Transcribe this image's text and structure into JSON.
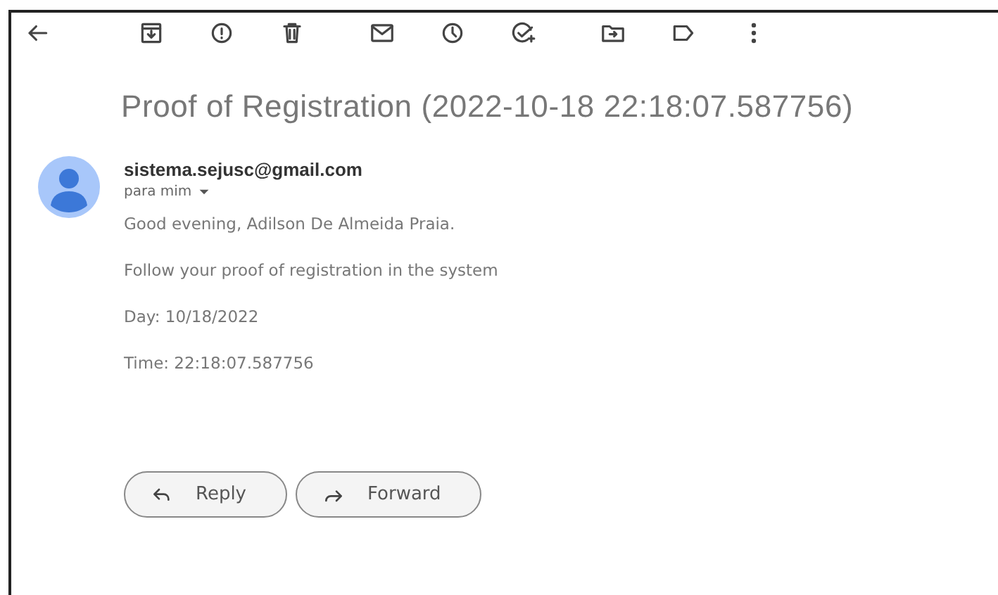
{
  "email": {
    "subject": "Proof of Registration (2022-10-18 22:18:07.587756)",
    "sender": "sistema.sejusc@gmail.com",
    "recipient": "para mim",
    "body": [
      "Good evening, Adilson De Almeida Praia.",
      "Follow your proof of registration in the system",
      "Day: 10/18/2022",
      "Time: 22:18:07.587756"
    ]
  },
  "actions": [
    {
      "kind": "reply",
      "label": "Reply"
    },
    {
      "kind": "forward",
      "label": "Forward"
    }
  ]
}
